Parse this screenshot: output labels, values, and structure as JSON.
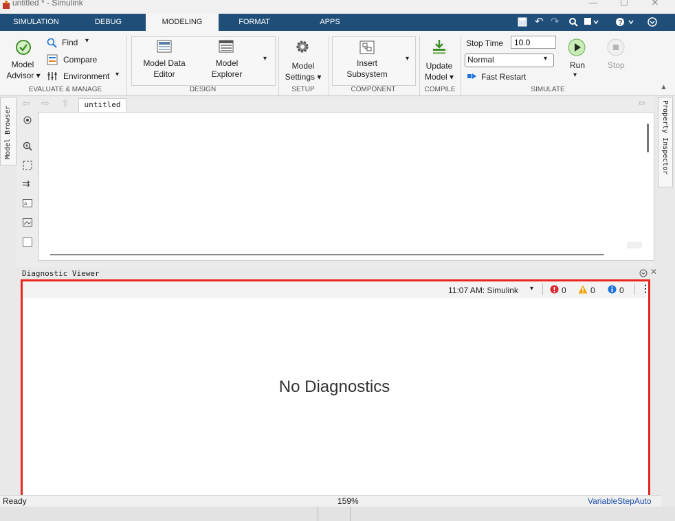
{
  "window": {
    "title": "untitled * - Simulink",
    "minimize": "—",
    "maximize": "☐",
    "close": "✕"
  },
  "tabs": [
    "SIMULATION",
    "DEBUG",
    "MODELING",
    "FORMAT",
    "APPS"
  ],
  "active_tab": "MODELING",
  "ribbon": {
    "evaluate": {
      "model_advisor": [
        "Model",
        "Advisor ▾"
      ],
      "find": "Find",
      "compare": "Compare",
      "environment": "Environment",
      "group": "EVALUATE & MANAGE"
    },
    "design": {
      "model_data_editor": [
        "Model Data",
        "Editor"
      ],
      "model_explorer": [
        "Model",
        "Explorer"
      ],
      "group": "DESIGN"
    },
    "setup": {
      "model_settings": [
        "Model",
        "Settings ▾"
      ],
      "group": "SETUP"
    },
    "component": {
      "insert_subsystem": [
        "Insert",
        "Subsystem"
      ],
      "group": "COMPONENT"
    },
    "compile": {
      "update_model": [
        "Update",
        "Model ▾"
      ],
      "group": "COMPILE"
    },
    "simulate": {
      "stop_time_label": "Stop Time",
      "stop_time_value": "10.0",
      "mode_value": "Normal",
      "fast_restart": "Fast Restart",
      "run": "Run",
      "stop": "Stop",
      "group": "SIMULATE"
    }
  },
  "editor": {
    "breadcrumb_tab": "untitled",
    "model_browser": "Model Browser",
    "property_inspector": "Property Inspector"
  },
  "diagnostics": {
    "panel_title": "Diagnostic Viewer",
    "session": "11:07 AM: Simulink",
    "errors": "0",
    "warnings": "0",
    "info": "0",
    "empty_message": "No Diagnostics"
  },
  "status": {
    "state": "Ready",
    "zoom": "159%",
    "solver": "VariableStepAuto"
  },
  "colors": {
    "tab_bar": "#1f4e79",
    "highlight": "#e8261f",
    "error": "#d9262e",
    "warning": "#f0a30a",
    "info": "#1e73d8"
  }
}
